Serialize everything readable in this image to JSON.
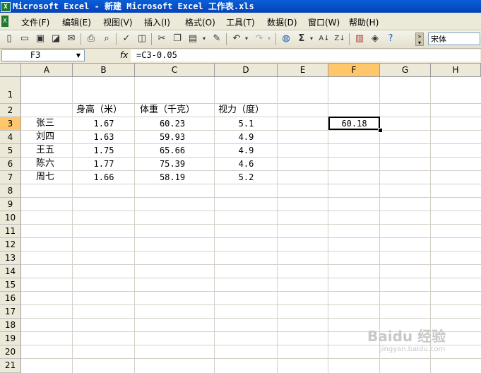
{
  "window": {
    "title": "Microsoft Excel - 新建 Microsoft Excel 工作表.xls"
  },
  "menu": [
    "文件(F)",
    "编辑(E)",
    "视图(V)",
    "插入(I)",
    "格式(O)",
    "工具(T)",
    "数据(D)",
    "窗口(W)",
    "帮助(H)"
  ],
  "toolbar": {
    "font_name": "宋体"
  },
  "formula_bar": {
    "name_box": "F3",
    "fx_label": "fx",
    "formula": "=C3-0.05"
  },
  "columns": [
    "A",
    "B",
    "C",
    "D",
    "E",
    "F",
    "G",
    "H"
  ],
  "rows": [
    "1",
    "2",
    "3",
    "4",
    "5",
    "6",
    "7",
    "8",
    "9",
    "10",
    "11",
    "12",
    "13",
    "14",
    "15",
    "16",
    "17",
    "18",
    "19",
    "20",
    "21"
  ],
  "headers": {
    "b": "身高（米）",
    "c": "体重（千克）",
    "d": "视力（度）"
  },
  "data_rows": [
    {
      "name": "张三",
      "height": "1.67",
      "weight": "60.23",
      "vision": "5.1"
    },
    {
      "name": "刘四",
      "height": "1.63",
      "weight": "59.93",
      "vision": "4.9"
    },
    {
      "name": "王五",
      "height": "1.75",
      "weight": "65.66",
      "vision": "4.9"
    },
    {
      "name": "陈六",
      "height": "1.77",
      "weight": "75.39",
      "vision": "4.6"
    },
    {
      "name": "周七",
      "height": "1.66",
      "weight": "58.19",
      "vision": "5.2"
    }
  ],
  "f3_value": "60.18",
  "watermark": {
    "main": "Baidu 经验",
    "sub": "jingyan.baidu.com"
  }
}
